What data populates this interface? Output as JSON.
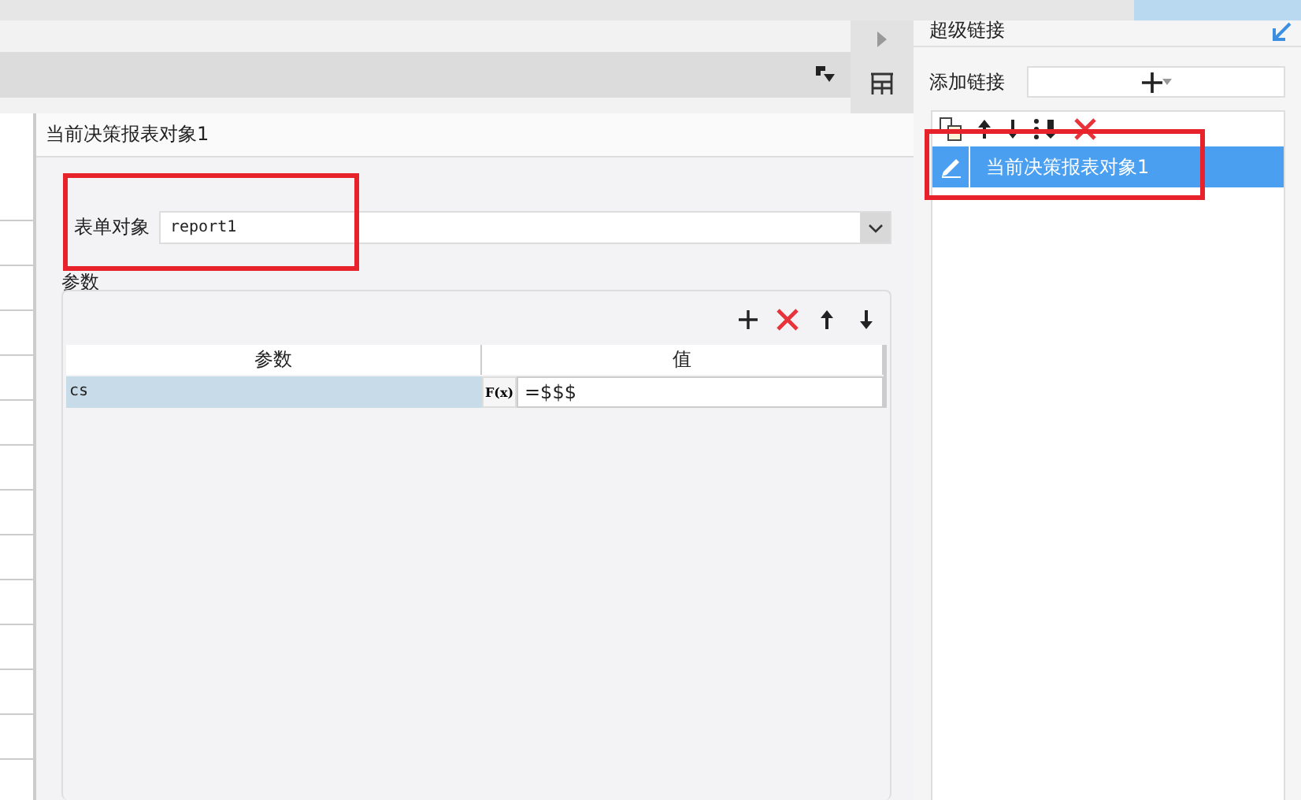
{
  "dialog": {
    "title": "当前决策报表对象1",
    "form_object": {
      "label": "表单对象",
      "value": "report1"
    },
    "params": {
      "title": "参数",
      "columns": [
        "参数",
        "值"
      ],
      "rows": [
        {
          "name": "cs",
          "formula_button": "F(x)",
          "value": "=$$$",
          "selected": true
        }
      ]
    }
  },
  "right_panel": {
    "title": "超级链接",
    "add_link": {
      "label": "添加链接"
    },
    "links": [
      {
        "label": "当前决策报表对象1",
        "selected": true
      }
    ]
  }
}
